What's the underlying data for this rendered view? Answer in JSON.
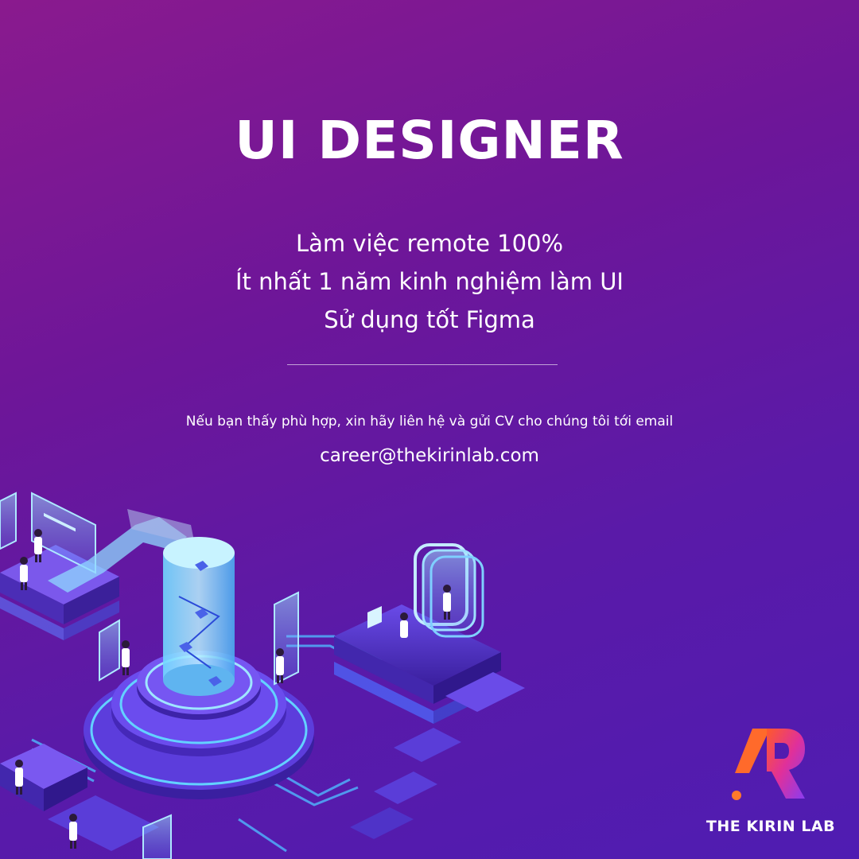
{
  "title": "UI DESIGNER",
  "requirements": [
    "Làm việc remote 100%",
    "Ít nhất 1 năm kinh nghiệm làm UI",
    "Sử dụng tốt Figma"
  ],
  "apply_text": "Nếu bạn thấy phù hợp, xin hãy liên hệ và gửi CV cho chúng tôi tới email",
  "email": "career@thekirinlab.com",
  "brand_name": "THE KIRIN LAB",
  "colors": {
    "background_start": "#8a1a8e",
    "background_end": "#4f1cb2",
    "text": "#ffffff",
    "logo_accent": "#ff6a2b"
  },
  "icons": [
    "isometric-lab-illustration",
    "kirin-logo-icon"
  ]
}
